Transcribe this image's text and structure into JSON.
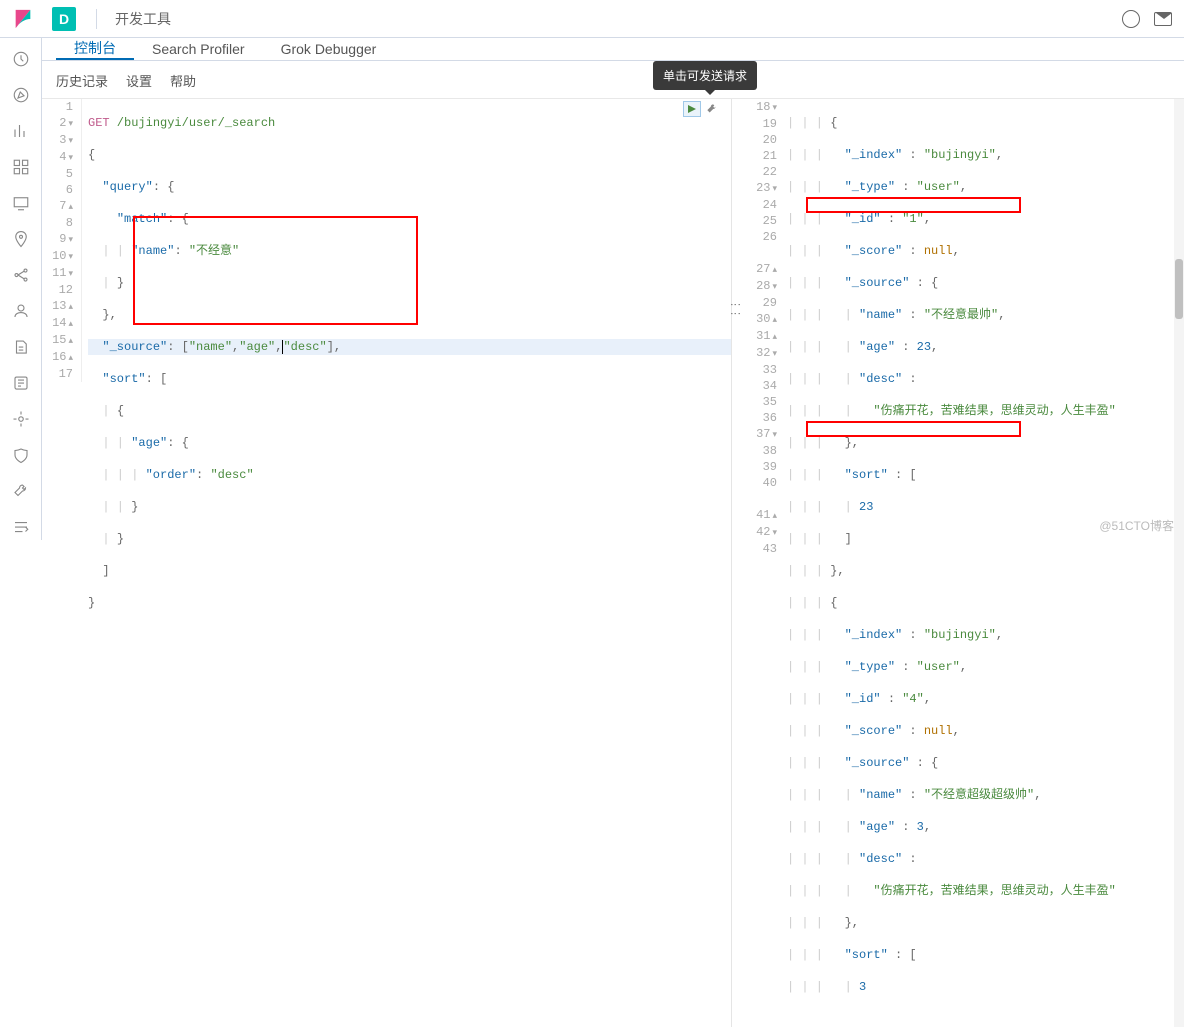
{
  "header": {
    "app_badge": "D",
    "app_title": "开发工具"
  },
  "tabs": {
    "console": "控制台",
    "search_profiler": "Search Profiler",
    "grok_debugger": "Grok Debugger"
  },
  "subnav": {
    "history": "历史记录",
    "settings": "设置",
    "help": "帮助"
  },
  "tooltip": "单击可发送请求",
  "left_editor": {
    "lines": [
      1,
      2,
      3,
      4,
      5,
      6,
      7,
      8,
      9,
      10,
      11,
      12,
      13,
      14,
      15,
      16,
      17
    ],
    "method": "GET",
    "endpoint": "/bujingyi/user/_search",
    "code_lines": {
      "l1_method": "GET",
      "l1_path": " /bujingyi/user/_search",
      "l2": "{",
      "l3_pre": "  ",
      "l3_key": "\"query\"",
      "l3_post": ": {",
      "l4_pre": "    ",
      "l4_key": "\"match\"",
      "l4_post": ": {",
      "l5_pre": "      ",
      "l5_key": "\"name\"",
      "l5_mid": ": ",
      "l5_val": "\"不经意\"",
      "l6": "    }",
      "l7": "  },",
      "l8_pre": "  ",
      "l8_key": "\"_source\"",
      "l8_mid": ": [",
      "l8_v1": "\"name\"",
      "l8_c1": ",",
      "l8_v2": "\"age\"",
      "l8_c2": ",",
      "l8_v3": "\"desc\"",
      "l8_end": "],",
      "l9_pre": "  ",
      "l9_key": "\"sort\"",
      "l9_post": ": [",
      "l10": "    {",
      "l11_pre": "      ",
      "l11_key": "\"age\"",
      "l11_post": ": {",
      "l12_pre": "        ",
      "l12_key": "\"order\"",
      "l12_mid": ": ",
      "l12_val": "\"desc\"",
      "l13": "      }",
      "l14": "    }",
      "l15": "  ]",
      "l16": "}"
    }
  },
  "right_editor": {
    "lines": [
      18,
      19,
      20,
      21,
      22,
      23,
      24,
      25,
      26,
      "",
      27,
      28,
      29,
      30,
      31,
      32,
      33,
      34,
      35,
      36,
      37,
      38,
      39,
      40,
      "",
      41,
      42,
      43
    ],
    "r": {
      "l18": "{",
      "l19_k": "\"_index\"",
      "l19_v": "\"bujingyi\"",
      "l20_k": "\"_type\"",
      "l20_v": "\"user\"",
      "l21_k": "\"_id\"",
      "l21_v": "\"1\"",
      "l22_k": "\"_score\"",
      "l22_v": "null",
      "l23_k": "\"_source\"",
      "l23_v": "{",
      "l24_k": "\"name\"",
      "l24_v": "\"不经意最帅\"",
      "l25_k": "\"age\"",
      "l25_v": "23",
      "l26_k": "\"desc\"",
      "l26_v": "",
      "l26b": "\"伤痛开花，苦难结果，思维灵动，人生丰盈\"",
      "l27": "},",
      "l28_k": "\"sort\"",
      "l28_v": "[",
      "l29": "23",
      "l30": "]",
      "l31": "},",
      "l32": "{",
      "l33_k": "\"_index\"",
      "l33_v": "\"bujingyi\"",
      "l34_k": "\"_type\"",
      "l34_v": "\"user\"",
      "l35_k": "\"_id\"",
      "l35_v": "\"4\"",
      "l36_k": "\"_score\"",
      "l36_v": "null",
      "l37_k": "\"_source\"",
      "l37_v": "{",
      "l38_k": "\"name\"",
      "l38_v": "\"不经意超级超级帅\"",
      "l39_k": "\"age\"",
      "l39_v": "3",
      "l40_k": "\"desc\"",
      "l40_v": "",
      "l40b": "\"伤痛开花，苦难结果，思维灵动，人生丰盈\"",
      "l41": "},",
      "l42_k": "\"sort\"",
      "l42_v": "[",
      "l43": "3"
    }
  },
  "watermark": "@51CTO博客"
}
